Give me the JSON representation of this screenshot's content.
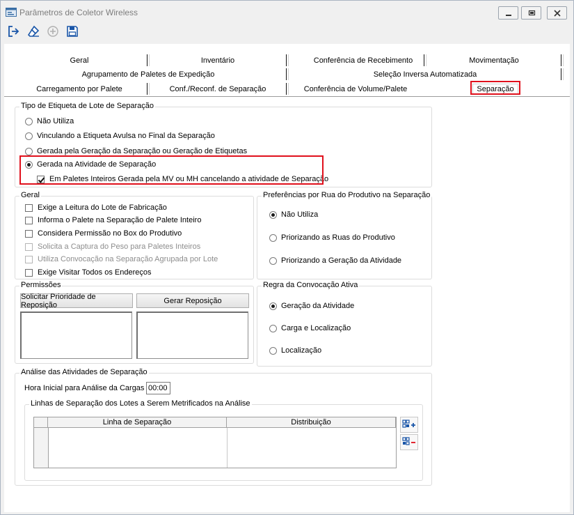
{
  "window": {
    "title": "Parâmetros de Coletor Wireless"
  },
  "toolbar": {
    "buttons": [
      {
        "name": "exit-icon",
        "color": "#1a56a8"
      },
      {
        "name": "eraser-icon",
        "color": "#1a56a8"
      },
      {
        "name": "add-circle-icon",
        "color": "#b0b0b0"
      },
      {
        "name": "save-icon",
        "color": "#1a56a8"
      }
    ]
  },
  "tabs": {
    "row1": [
      "Geral",
      "Inventário",
      "Conferência de Recebimento",
      "Movimentação"
    ],
    "row2": [
      "Agrupamento de Paletes de Expedição",
      "Seleção Inversa Automatizada"
    ],
    "row3": [
      "Carregamento por Palete",
      "Conf./Reconf. de Separação",
      "Conferência de Volume/Palete",
      "Separação"
    ],
    "active": "Separação"
  },
  "tipo_etiqueta": {
    "legend": "Tipo de Etiqueta de Lote de Separação",
    "options": [
      {
        "label": "Não Utiliza",
        "selected": false
      },
      {
        "label": "Vinculando a Etiqueta Avulsa no Final da Separação",
        "selected": false
      },
      {
        "label": "Gerada pela Geração da Separação ou Geração de Etiquetas",
        "selected": false
      },
      {
        "label": "Gerada na Atividade de Separação",
        "selected": true
      }
    ],
    "sub_check": {
      "label": "Em Paletes Inteiros Gerada pela MV ou MH cancelando a atividade de Separação",
      "checked": true
    }
  },
  "geral": {
    "legend": "Geral",
    "checks": [
      {
        "label": "Exige a Leitura do Lote de Fabricação",
        "checked": false,
        "enabled": true
      },
      {
        "label": "Informa o Palete na Separação de Palete Inteiro",
        "checked": false,
        "enabled": true
      },
      {
        "label": "Considera Permissão no Box do Produtivo",
        "checked": false,
        "enabled": true
      },
      {
        "label": "Solicita a Captura do Peso para Paletes Inteiros",
        "checked": false,
        "enabled": false
      },
      {
        "label": "Utiliza Convocação na Separação Agrupada por Lote",
        "checked": false,
        "enabled": false
      },
      {
        "label": "Exige Visitar Todos os Endereços",
        "checked": false,
        "enabled": true
      }
    ]
  },
  "preferencias": {
    "legend": "Preferências por Rua do Produtivo na Separação",
    "options": [
      {
        "label": "Não Utiliza",
        "selected": true
      },
      {
        "label": "Priorizando as Ruas do Produtivo",
        "selected": false
      },
      {
        "label": "Priorizando a Geração da Atividade",
        "selected": false
      }
    ]
  },
  "permissoes": {
    "legend": "Permissões",
    "btn_prioridade": "Solicitar Prioridade de Reposição",
    "btn_gerar": "Gerar Reposição"
  },
  "regra": {
    "legend": "Regra da Convocação Ativa",
    "options": [
      {
        "label": "Geração da Atividade",
        "selected": true
      },
      {
        "label": "Carga e Localização",
        "selected": false
      },
      {
        "label": "Localização",
        "selected": false
      }
    ]
  },
  "analise": {
    "legend": "Análise das Atividades de Separação",
    "hora_label": "Hora Inicial para Análise da Cargas",
    "hora_value": "00:00",
    "linhas_legend": "Linhas de Separação dos Lotes a Serem Metrificados na Análise",
    "columns": [
      "Linha de Separação",
      "Distribuição"
    ],
    "add_icon": "add-row-icon",
    "remove_icon": "remove-row-icon"
  },
  "highlight_color": "#e0101c"
}
